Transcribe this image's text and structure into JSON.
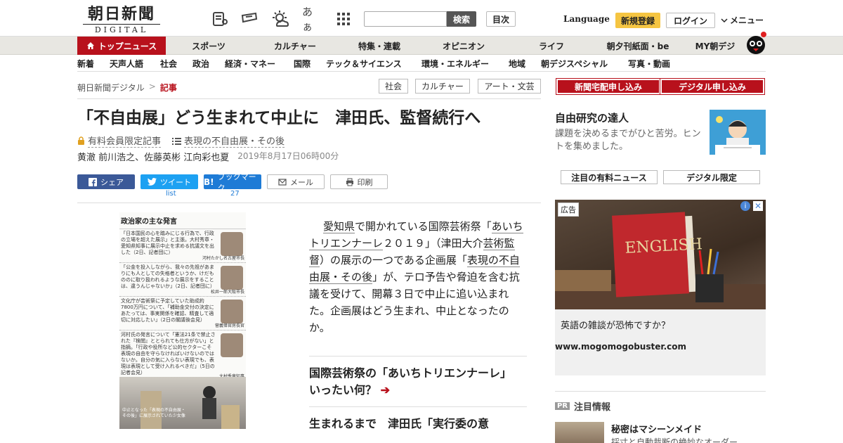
{
  "header": {
    "logo_main": "朝日新聞",
    "logo_sub": "DIGITAL",
    "search_button": "検索",
    "toc_button": "目次",
    "language": "Language",
    "register": "新規登録",
    "login": "ログイン",
    "menu": "メニュー",
    "font_size_icon_text": "あぁ"
  },
  "nav_primary": [
    "トップニュース",
    "スポーツ",
    "カルチャー",
    "特集・連載",
    "オピニオン",
    "ライフ",
    "朝夕刊紙面・be",
    "MY朝デジ"
  ],
  "nav_secondary": [
    "新着",
    "天声人語",
    "社会",
    "政治",
    "経済・マネー",
    "国際",
    "テック＆サイエンス",
    "環境・エネルギー",
    "地域",
    "朝デジスペシャル",
    "写真・動画"
  ],
  "breadcrumb": {
    "home": "朝日新聞デジタル",
    "sep": ">",
    "current": "記事"
  },
  "tags": [
    "社会",
    "カルチャー",
    "アート・文芸"
  ],
  "article": {
    "headline": "「不自由展」どう生まれて中止に　津田氏、監督続行へ",
    "members_only": "有料会員限定記事",
    "series": "表現の不自由展・その後",
    "authors": "黄澈 前川浩之、佐藤英彬 江向彩也夏",
    "date": "2019年8月17日06時00分",
    "share": {
      "facebook": "シェア",
      "twitter": "ツイート",
      "twitter_sub": "list",
      "hatena": "ブックマーク",
      "hatena_count": "27",
      "mail": "メール",
      "print": "印刷"
    },
    "body": {
      "p1": "愛知県",
      "p2": "で開かれている国際芸術祭「",
      "p3": "あいちトリエンナーレ",
      "p4": "２０１９」（津田大介",
      "p5": "芸術監督",
      "p6": "）の展示の一つである企画展「",
      "p7": "表現の不自由展・その後",
      "p8": "」が、テロ予告や脅迫を含む抗議を受けて、開幕３日で中止に追い込まれた。企画展はどう生まれ、中止となったのか。"
    },
    "related": [
      "国際芸術祭の「あいちトリエンナーレ」　いったい何？",
      "生まれるまで　津田氏「実行委の意"
    ]
  },
  "figure": {
    "title": "政治家の主な発言",
    "quotes": [
      {
        "text": "「日本国民の心を踏みにじる行為で、行政の立場を超えた展示」と主張。大村秀章・愛知県知事に展示中止を求める抗議文を出した（2日、記者団に）",
        "name": "河村たかし名古屋市長"
      },
      {
        "text": "「公金を投入しながら、我々の先祖があまりにも人としての失格者というか、けだもののに取り扱われるような展示をすることは、違うんじゃないか」（2日、記者団に）",
        "name": "松井一郎大阪市長"
      },
      {
        "text": "文化庁が芸術祭に予定していた助成約7800万円について、「補助金交付の決定にあたっては、事実関係を確認、精査して適切に対応したい」（2日の閣議後会見）",
        "name": "菅義偉官房長官"
      },
      {
        "text": "河村氏の発言について「憲法21条で禁止された『検閲』ととられても仕方がない」と指摘。「行政や役所など公的セクターこそ表現の自由を守らなければいけないのではないか。自分の気に入らない表現でも、表現は表現として受け入れるべきだ」（5日の記者会見）",
        "name": "大村秀章知事"
      }
    ],
    "caption": "中止となった「表現の不自由展・その後」に展示されていた少女像"
  },
  "sidebar": {
    "subscribe_paper": "新聞宅配申し込み",
    "subscribe_digital": "デジタル申し込み",
    "feature_title": "自由研究の達人",
    "feature_desc": "課題を決めるまでがひと苦労。ヒントを集めました。",
    "tab_paid": "注目の有料ニュース",
    "tab_digital": "デジタル限定",
    "ad": {
      "label": "広告",
      "book_text": "ENGLISH",
      "text": "英語の雑談が恐怖ですか？",
      "url": "www.mogomogobuster.com"
    },
    "pr_badge": "PR",
    "pr_label": "注目情報",
    "pr_title": "秘密はマシーンメイド",
    "pr_desc": "採寸と自動裁断の絶妙なオーダー"
  },
  "colors": {
    "brand_red": "#b8111c",
    "register_yellow": "#f5c542",
    "facebook": "#3b5998",
    "twitter": "#1da1f2",
    "hatena": "#1e7bd6"
  }
}
